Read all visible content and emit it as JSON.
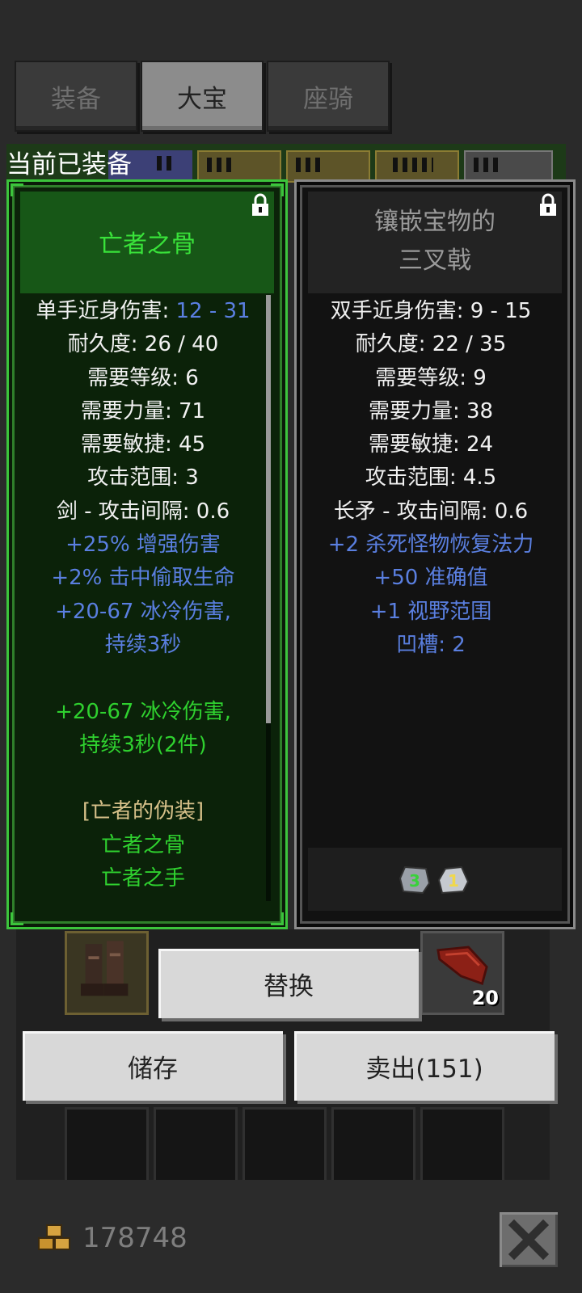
{
  "tabs": [
    {
      "label": "装备",
      "active": false
    },
    {
      "label": "大宝",
      "active": true
    },
    {
      "label": "座骑",
      "active": false
    }
  ],
  "equipped_label": "当前已装备",
  "left_item": {
    "title": "亡者之骨",
    "lines": [
      {
        "a": "单手近身伤害: ",
        "b": "12 - 31"
      },
      {
        "a": "耐久度: 26 / 40"
      },
      {
        "a": "需要等级: 6"
      },
      {
        "a": "需要力量: 71"
      },
      {
        "a": "需要敏捷: 45"
      },
      {
        "a": "攻击范围: 3"
      },
      {
        "a": "剑 - 攻击间隔: 0.6"
      },
      {
        "blue": "+25% 增强伤害"
      },
      {
        "blue": "+2% 击中偷取生命"
      },
      {
        "blue": "+20-67 冰冷伤害,"
      },
      {
        "blue": "持续3秒"
      },
      {
        "green": "+20-67 冰冷伤害,"
      },
      {
        "green": "持续3秒(2件)"
      },
      {
        "yellow": "[亡者的伪装]"
      },
      {
        "green": "亡者之骨"
      },
      {
        "green": "亡者之手"
      }
    ]
  },
  "right_item": {
    "title_line1": "镶嵌宝物的",
    "title_line2": "三叉戟",
    "lines": [
      {
        "a": "双手近身伤害: 9 - 15"
      },
      {
        "a": "耐久度: 22 / 35"
      },
      {
        "a": "需要等级: 9"
      },
      {
        "a": "需要力量: 38"
      },
      {
        "a": "需要敏捷: 24"
      },
      {
        "a": "攻击范围: 4.5"
      },
      {
        "a": "长矛 - 攻击间隔: 0.6"
      },
      {
        "blue": "+2 杀死怪物恢复法力"
      },
      {
        "blue": "+50 准确值"
      },
      {
        "blue": "+1 视野范围"
      },
      {
        "blue": "凹槽: 2"
      }
    ],
    "gems": [
      {
        "label": "3",
        "color": "#39d13a"
      },
      {
        "label": "1",
        "color": "#f0d84a"
      }
    ]
  },
  "buttons": {
    "replace": "替换",
    "store": "储存",
    "sell": "卖出(151)"
  },
  "inventory": {
    "stack_count": "20"
  },
  "gold": "178748",
  "colors": {
    "set_green": "#39e23a",
    "magic_blue": "#5a7fe0",
    "set_name_yellow": "#d6c089"
  }
}
